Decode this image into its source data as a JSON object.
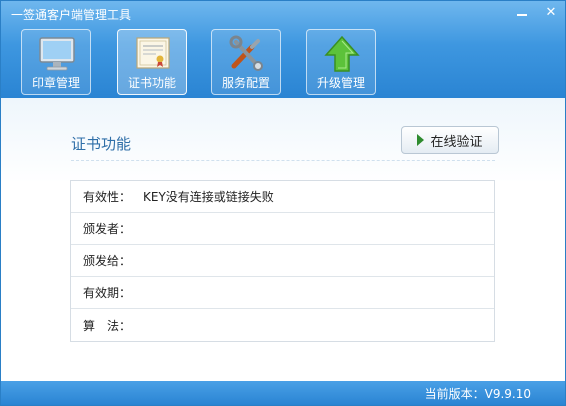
{
  "window": {
    "title": "一签通客户端管理工具"
  },
  "toolbar": {
    "items": [
      {
        "label": "印章管理",
        "icon": "monitor-icon"
      },
      {
        "label": "证书功能",
        "icon": "certificate-icon"
      },
      {
        "label": "服务配置",
        "icon": "tools-icon"
      },
      {
        "label": "升级管理",
        "icon": "upgrade-arrow-icon"
      }
    ]
  },
  "main": {
    "section_title": "证书功能",
    "verify_button": "在线验证",
    "fields": [
      {
        "label": "有效性：",
        "value": "KEY没有连接或链接失败"
      },
      {
        "label": "颁发者：",
        "value": ""
      },
      {
        "label": "颁发给：",
        "value": ""
      },
      {
        "label": "有效期：",
        "value": ""
      },
      {
        "label": "算　法：",
        "value": ""
      }
    ]
  },
  "status": {
    "version": "当前版本：V9.9.10"
  },
  "colors": {
    "accent": "#2a84d3",
    "title_text": "#2f6fa8",
    "verify_play": "#2e8b2e"
  }
}
